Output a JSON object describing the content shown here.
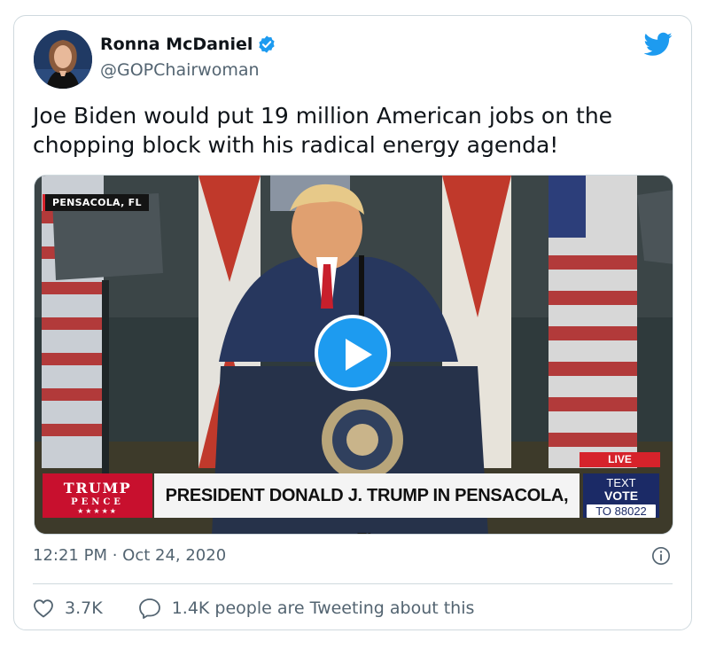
{
  "tweet": {
    "author_name": "Ronna McDaniel",
    "author_handle": "@GOPChairwoman",
    "text": "Joe Biden would put 19 million American jobs on the chopping block with his radical energy agenda!",
    "timestamp": "12:21 PM · Oct 24, 2020",
    "likes": "3.7K",
    "conversation": "1.4K people are Tweeting about this"
  },
  "video": {
    "location_tag": "PENSACOLA, FL",
    "live_label": "LIVE",
    "headline": "PRESIDENT DONALD J. TRUMP IN PENSACOLA, FL",
    "logo_line1": "TRUMP",
    "logo_line2": "PENCE",
    "logo_stars": "★★★★★",
    "vote_line1": "TEXT",
    "vote_line2": "VOTE",
    "vote_line3": "TO 88022"
  },
  "icons": {
    "verified": "verified-badge-icon",
    "brand": "twitter-bird-icon",
    "play": "play-icon",
    "info": "info-icon",
    "like": "heart-icon",
    "reply": "speech-bubble-icon"
  },
  "colors": {
    "accent": "#1d9bf0",
    "secondary_text": "#536471",
    "border": "#cfd9de",
    "news_red": "#c8102e",
    "news_blue": "#1b2a66"
  }
}
